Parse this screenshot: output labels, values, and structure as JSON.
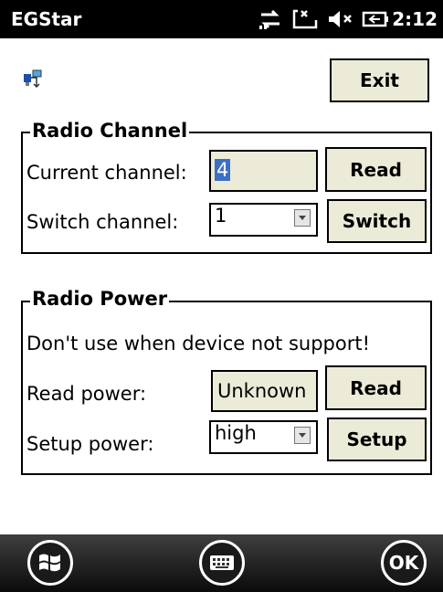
{
  "statusbar": {
    "app_title": "EGStar",
    "time": "2:12",
    "icons": [
      "connectivity-icon",
      "data-sync-icon",
      "speaker-muted-icon",
      "battery-icon"
    ]
  },
  "toolbar": {
    "exit_label": "Exit"
  },
  "radio_channel": {
    "title": "Radio Channel",
    "current_label": "Current channel:",
    "current_value": "4",
    "read_label": "Read",
    "switch_label_text": "Switch channel:",
    "switch_value": "1",
    "switch_button": "Switch"
  },
  "radio_power": {
    "title": "Radio Power",
    "warning": "Don't use when device not support!",
    "read_power_label": "Read power:",
    "read_power_value": "Unknown",
    "read_button": "Read",
    "setup_power_label": "Setup power:",
    "setup_power_value": "high",
    "setup_button": "Setup"
  },
  "bottombar": {
    "ok_label": "OK",
    "icons": [
      "windows-start-icon",
      "keyboard-icon",
      "ok-icon"
    ]
  }
}
